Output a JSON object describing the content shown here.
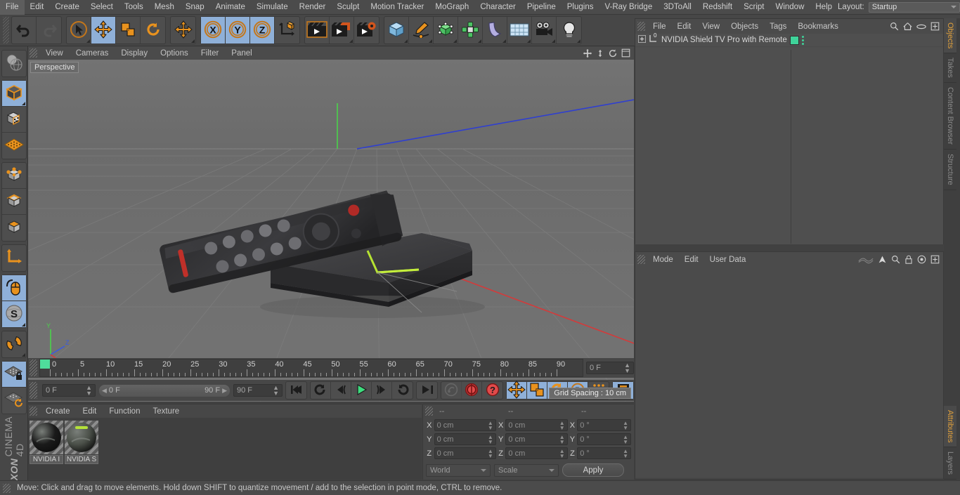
{
  "app": {
    "brand_1": "MAXON",
    "brand_2": "CINEMA 4D"
  },
  "menubar": {
    "items": [
      {
        "label": "File"
      },
      {
        "label": "Edit"
      },
      {
        "label": "Create"
      },
      {
        "label": "Select"
      },
      {
        "label": "Tools"
      },
      {
        "label": "Mesh"
      },
      {
        "label": "Snap"
      },
      {
        "label": "Animate"
      },
      {
        "label": "Simulate"
      },
      {
        "label": "Render"
      },
      {
        "label": "Sculpt"
      },
      {
        "label": "Motion Tracker"
      },
      {
        "label": "MoGraph"
      },
      {
        "label": "Character"
      },
      {
        "label": "Pipeline"
      },
      {
        "label": "Plugins"
      },
      {
        "label": "V-Ray Bridge"
      },
      {
        "label": "3DToAll"
      },
      {
        "label": "Redshift"
      },
      {
        "label": "Script"
      },
      {
        "label": "Window"
      },
      {
        "label": "Help"
      }
    ],
    "layout_label": "Layout:",
    "layout_value": "Startup",
    "search_icon": "search-icon"
  },
  "toolbar": {
    "groups": [
      {
        "name": "history",
        "buttons": [
          {
            "name": "undo-button",
            "icon": "undo-icon",
            "active": false,
            "dim": false
          },
          {
            "name": "redo-button",
            "icon": "redo-icon",
            "active": false,
            "dim": true
          }
        ]
      },
      {
        "name": "transform-tools",
        "buttons": [
          {
            "name": "live-selection-tool",
            "icon": "cursor-circle-icon",
            "active": false,
            "dim": false,
            "corner": true
          },
          {
            "name": "move-tool",
            "icon": "move-arrows-icon",
            "active": true,
            "dim": false
          },
          {
            "name": "scale-tool",
            "icon": "scale-box-icon",
            "active": false,
            "dim": false
          },
          {
            "name": "rotate-tool",
            "icon": "rotate-arrow-icon",
            "active": false,
            "dim": false
          }
        ]
      },
      {
        "name": "move-alt",
        "buttons": [
          {
            "name": "move-tool-alt",
            "icon": "move-arrows-icon",
            "active": false,
            "dim": false,
            "corner": true
          }
        ]
      },
      {
        "name": "axis-locks",
        "buttons": [
          {
            "name": "lock-x-axis-button",
            "icon": "x-axis-icon",
            "active": true,
            "dim": false
          },
          {
            "name": "lock-y-axis-button",
            "icon": "y-axis-icon",
            "active": true,
            "dim": false
          },
          {
            "name": "lock-z-axis-button",
            "icon": "z-axis-icon",
            "active": true,
            "dim": false
          },
          {
            "name": "world-coordinate-button",
            "icon": "world-axis-icon",
            "active": false,
            "dim": false
          }
        ]
      },
      {
        "name": "render-tools",
        "buttons": [
          {
            "name": "render-view-button",
            "icon": "clapperboard-icon",
            "active": false,
            "dim": false
          },
          {
            "name": "render-region-button",
            "icon": "clapperboard-window-icon",
            "active": false,
            "dim": false,
            "corner": true
          },
          {
            "name": "render-settings-button",
            "icon": "clapperboard-gear-icon",
            "active": false,
            "dim": false
          }
        ]
      },
      {
        "name": "create-tools",
        "buttons": [
          {
            "name": "add-cube-button",
            "icon": "cube-icon",
            "active": false,
            "dim": false,
            "corner": true
          },
          {
            "name": "add-spline-button",
            "icon": "pen-spline-icon",
            "active": false,
            "dim": false,
            "corner": true
          },
          {
            "name": "add-nurbs-button",
            "icon": "green-cube-icon",
            "active": false,
            "dim": false,
            "corner": true
          },
          {
            "name": "add-array-button",
            "icon": "cluster-icon",
            "active": false,
            "dim": false,
            "corner": true
          },
          {
            "name": "add-deformer-button",
            "icon": "bend-icon",
            "active": false,
            "dim": false,
            "corner": true
          },
          {
            "name": "add-scene-button",
            "icon": "floor-grid-icon",
            "active": false,
            "dim": false,
            "corner": true
          },
          {
            "name": "add-camera-button",
            "icon": "camera-icon",
            "active": false,
            "dim": false,
            "corner": true
          },
          {
            "name": "add-light-button",
            "icon": "light-bulb-icon",
            "active": false,
            "dim": false,
            "corner": true
          }
        ]
      }
    ]
  },
  "left_toolbar": {
    "groups": [
      {
        "buttons": [
          {
            "name": "make-editable-button",
            "icon": "globe-deform-icon",
            "active": false
          }
        ]
      },
      {
        "buttons": [
          {
            "name": "model-mode-button",
            "icon": "model-cube-icon",
            "active": true,
            "corner": true
          },
          {
            "name": "texture-mode-button",
            "icon": "texture-cube-icon",
            "active": false
          },
          {
            "name": "workplane-mode-button",
            "icon": "workplane-grid-icon",
            "active": false
          }
        ]
      },
      {
        "buttons": [
          {
            "name": "points-mode-button",
            "icon": "points-cube-icon",
            "active": false
          },
          {
            "name": "edges-mode-button",
            "icon": "edges-cube-icon",
            "active": false
          },
          {
            "name": "polygons-mode-button",
            "icon": "polygon-cube-icon",
            "active": false
          }
        ]
      },
      {
        "buttons": [
          {
            "name": "object-axis-button",
            "icon": "axis-arrow-icon",
            "active": false
          }
        ]
      },
      {
        "buttons": [
          {
            "name": "enable-axis-button",
            "icon": "mouse-axis-icon",
            "active": true
          },
          {
            "name": "enable-snap-button",
            "icon": "snap-s-icon",
            "active": true,
            "corner": true
          }
        ]
      },
      {
        "buttons": [
          {
            "name": "magnet-tool-button",
            "icon": "magnet-icon",
            "active": false,
            "corner": true
          }
        ]
      },
      {
        "buttons": [
          {
            "name": "workplane-lock-button",
            "icon": "grid-lock-icon",
            "active": true
          },
          {
            "name": "workplane-rotate-button",
            "icon": "grid-rotate-icon",
            "active": false
          }
        ]
      }
    ]
  },
  "viewport": {
    "menu": [
      {
        "label": "View"
      },
      {
        "label": "Cameras"
      },
      {
        "label": "Display"
      },
      {
        "label": "Options"
      },
      {
        "label": "Filter"
      },
      {
        "label": "Panel"
      }
    ],
    "label": "Perspective",
    "grid_spacing": "Grid Spacing : 10 cm",
    "axis_labels": {
      "x": "X",
      "y": "Y",
      "z": "Z"
    },
    "icons": [
      "pan-view-icon",
      "zoom-view-icon",
      "rotate-view-icon",
      "maximize-view-icon"
    ],
    "scene_description": "NVIDIA Shield TV Pro console with remote control on grid floor"
  },
  "timeline": {
    "start_frame": "0",
    "end_frame": "90",
    "tick_labels": [
      "0",
      "5",
      "10",
      "15",
      "20",
      "25",
      "30",
      "35",
      "40",
      "45",
      "50",
      "55",
      "60",
      "65",
      "70",
      "75",
      "80",
      "85",
      "90"
    ],
    "current_frame_field": "0 F",
    "playhead_position": 0
  },
  "playback": {
    "current_frame": "0 F",
    "range_start": "0 F",
    "range_end": "90 F",
    "preview_end": "90 F",
    "buttons": [
      {
        "name": "go-to-start-button",
        "icon": "skip-start-icon",
        "active": false,
        "dim": false
      },
      {
        "name": "previous-keyframe-button",
        "icon": "prev-key-icon",
        "active": false,
        "dim": false
      },
      {
        "name": "previous-frame-button",
        "icon": "step-back-icon",
        "active": false,
        "dim": false
      },
      {
        "name": "play-button",
        "icon": "play-icon",
        "active": false,
        "dim": false
      },
      {
        "name": "next-frame-button",
        "icon": "step-forward-icon",
        "active": false,
        "dim": false
      },
      {
        "name": "next-keyframe-button",
        "icon": "next-key-icon",
        "active": false,
        "dim": false
      },
      {
        "name": "go-to-end-button",
        "icon": "skip-end-icon",
        "active": false,
        "dim": false
      },
      {
        "name": "record-active-objects-button",
        "icon": "key-icon",
        "active": false,
        "dim": true
      },
      {
        "name": "autokeying-button",
        "icon": "red-circle-icon",
        "active": false,
        "dim": false
      },
      {
        "name": "keyframe-selection-button",
        "icon": "red-question-icon",
        "active": false,
        "dim": false
      },
      {
        "name": "record-position-button",
        "icon": "move-arrows-icon",
        "active": true,
        "dim": false
      },
      {
        "name": "record-scale-button",
        "icon": "scale-box-icon",
        "active": true,
        "dim": false
      },
      {
        "name": "record-rotation-button",
        "icon": "rotate-arrow-icon",
        "active": true,
        "dim": false
      },
      {
        "name": "record-parameter-button",
        "icon": "p-circle-icon",
        "active": true,
        "dim": false
      },
      {
        "name": "record-pla-button",
        "icon": "dots-grid-icon",
        "active": false,
        "dim": false
      },
      {
        "name": "timeline-mode-button",
        "icon": "film-strip-icon",
        "active": true,
        "dim": false
      }
    ]
  },
  "material_manager": {
    "menu": [
      {
        "label": "Create"
      },
      {
        "label": "Edit"
      },
      {
        "label": "Function"
      },
      {
        "label": "Texture"
      }
    ],
    "materials": [
      {
        "name": "NVIDIA I",
        "color": "#1a1a1a",
        "highlight": "none"
      },
      {
        "name": "NVIDIA S",
        "color": "#4a4f48",
        "highlight": "#b5e23a"
      }
    ]
  },
  "coordinates": {
    "header": [
      "--",
      "--",
      "--"
    ],
    "rows": [
      {
        "axis": "X",
        "position": "0 cm",
        "size": "0 cm",
        "rotation": "0 °"
      },
      {
        "axis": "Y",
        "position": "0 cm",
        "size": "0 cm",
        "rotation": "0 °"
      },
      {
        "axis": "Z",
        "position": "0 cm",
        "size": "0 cm",
        "rotation": "0 °"
      }
    ],
    "coord_system": "World",
    "size_mode": "Scale",
    "apply_label": "Apply"
  },
  "object_manager": {
    "menu": [
      {
        "label": "File"
      },
      {
        "label": "Edit"
      },
      {
        "label": "View"
      },
      {
        "label": "Objects"
      },
      {
        "label": "Tags"
      },
      {
        "label": "Bookmarks"
      }
    ],
    "icons": [
      "search-icon",
      "home-icon",
      "ellipse-icon",
      "expand-icon"
    ],
    "objects": [
      {
        "name": "NVIDIA Shield TV Pro with Remote",
        "layer_badge": "0",
        "tag_color": "#3fd39a",
        "visible": true
      }
    ]
  },
  "attribute_manager": {
    "menu": [
      {
        "label": "Mode"
      },
      {
        "label": "Edit"
      },
      {
        "label": "User Data"
      }
    ],
    "icons": [
      "wave-icon",
      "arrow-up-icon",
      "search-icon",
      "lock-icon",
      "target-icon",
      "expand-icon"
    ]
  },
  "right_tabs": {
    "upper": [
      {
        "label": "Objects",
        "selected": true
      },
      {
        "label": "Takes",
        "selected": false
      },
      {
        "label": "Content Browser",
        "selected": false
      },
      {
        "label": "Structure",
        "selected": false
      }
    ],
    "lower": [
      {
        "label": "Attributes",
        "selected": true
      },
      {
        "label": "Layers",
        "selected": false
      }
    ]
  },
  "statusbar": {
    "message": "Move: Click and drag to move elements. Hold down SHIFT to quantize movement / add to the selection in point mode, CTRL to remove."
  },
  "colors": {
    "accent_orange": "#e0a03c",
    "active_blue": "#8fb0d8",
    "tag_green": "#3fd39a",
    "panel_bg": "#474747",
    "viewport_bg": "#6c6c6c"
  }
}
